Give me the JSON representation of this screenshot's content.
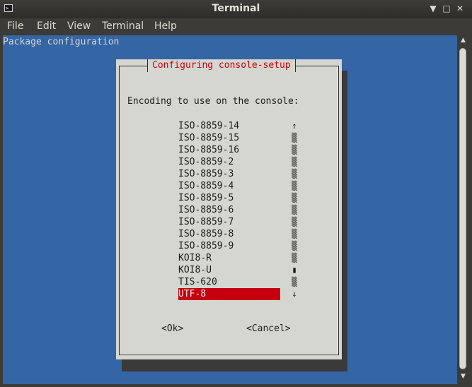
{
  "window": {
    "title": "Terminal",
    "minimize": "▼",
    "maximize": "□",
    "close": "✕",
    "app_icon": ">_"
  },
  "menu": {
    "items": [
      {
        "label": "File"
      },
      {
        "label": "Edit"
      },
      {
        "label": "View"
      },
      {
        "label": "Terminal"
      },
      {
        "label": "Help"
      }
    ]
  },
  "terminal": {
    "header": "Package configuration"
  },
  "dialog": {
    "title": "Configuring console-setup",
    "prompt": "Encoding to use on the console:",
    "options": [
      "ISO-8859-14",
      "ISO-8859-15",
      "ISO-8859-16",
      "ISO-8859-2",
      "ISO-8859-3",
      "ISO-8859-4",
      "ISO-8859-5",
      "ISO-8859-6",
      "ISO-8859-7",
      "ISO-8859-8",
      "ISO-8859-9",
      "KOI8-R",
      "KOI8-U",
      "TIS-620",
      "UTF-8"
    ],
    "selected": "UTF-8",
    "scroll_up": "↑",
    "scroll_down": "↓",
    "ok_label": "<Ok>",
    "cancel_label": "<Cancel>"
  },
  "colors": {
    "terminal_bg": "#3465a4",
    "dialog_bg": "#d6d6d0",
    "accent": "#c4000e"
  }
}
